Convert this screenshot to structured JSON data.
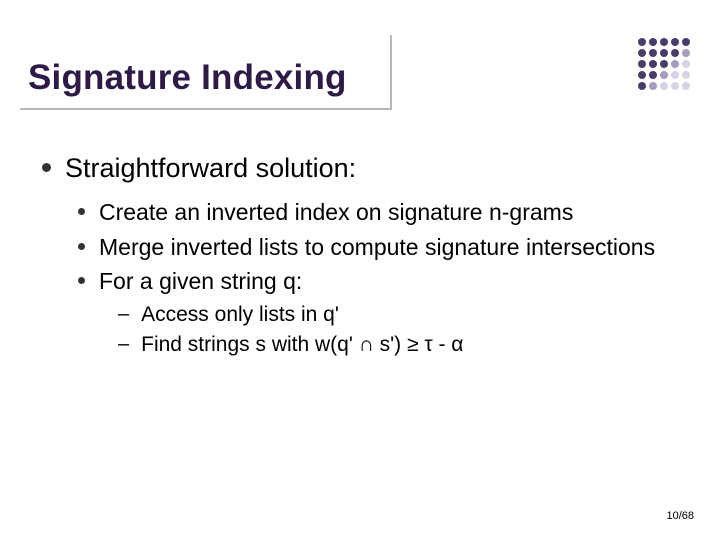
{
  "title": "Signature Indexing",
  "level1": {
    "items": [
      {
        "text": "Straightforward solution:"
      }
    ]
  },
  "level2": {
    "items": [
      {
        "text": "Create an inverted index on signature n-grams"
      },
      {
        "text": "Merge inverted lists to compute signature intersections"
      },
      {
        "text": "For a given string q:"
      }
    ]
  },
  "level3": {
    "items": [
      {
        "text": "Access only lists in q'"
      },
      {
        "text": "Find strings s with w(q' ∩ s') ≥ τ - α"
      }
    ]
  },
  "page": "10/68"
}
